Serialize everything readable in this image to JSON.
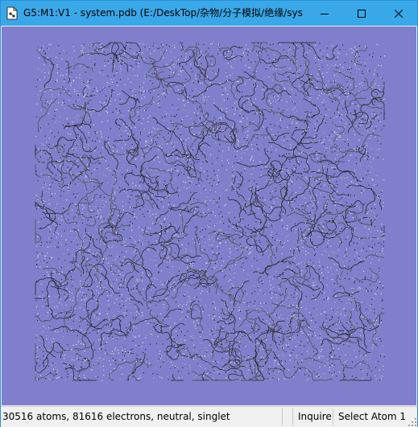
{
  "window": {
    "title": "G5:M1:V1 - system.pdb (E:/DeskTop/杂物/分子模拟/绝缘/sys...",
    "app_icon": "gaussview-document-icon",
    "controls": {
      "minimize_icon": "minimize-icon",
      "maximize_icon": "maximize-icon",
      "close_icon": "close-icon"
    }
  },
  "viewport": {
    "background_color": "#7f7fcb",
    "content": "molecular-structure-render",
    "atom_colors": [
      "#1e1e1e",
      "#4a4a4a",
      "#e8e8e8",
      "#b8b8b8"
    ]
  },
  "statusbar": {
    "summary": "30516 atoms, 81616 electrons, neutral, singlet",
    "mode": "Inquire",
    "selection": "Select Atom 1"
  }
}
